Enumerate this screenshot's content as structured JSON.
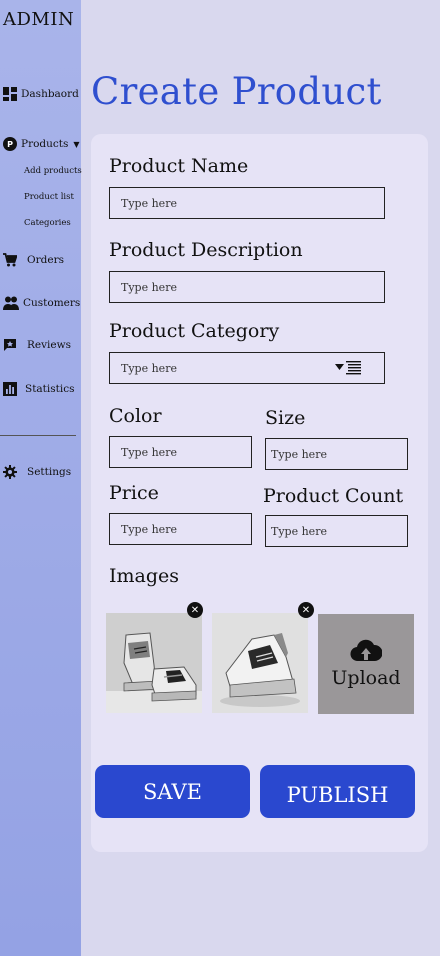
{
  "sidebar": {
    "brand": "ADMIN",
    "items": {
      "dashboard": "Dashbaord",
      "products": "Products",
      "orders": "Orders",
      "customers": "Customers",
      "reviews": "Reviews",
      "statistics": "Statistics",
      "settings": "Settings"
    },
    "product_sub": [
      "Add products",
      "Product list",
      "Categories"
    ]
  },
  "page_title": "Create Product",
  "form": {
    "name_label": "Product Name",
    "description_label": "Product Description",
    "category_label": "Product Category",
    "color_label": "Color",
    "size_label": "Size",
    "price_label": "Price",
    "count_label": "Product Count",
    "images_label": "Images",
    "placeholder": "Type here",
    "upload_label": "Upload"
  },
  "buttons": {
    "save": "SAVE",
    "publish": "PUBLISH"
  },
  "colors": {
    "accent": "#2a48cf",
    "title": "#2f4fcf",
    "sidebar": "#a9b4ea",
    "card": "#e6e3f6",
    "background": "#d9d8ee"
  }
}
